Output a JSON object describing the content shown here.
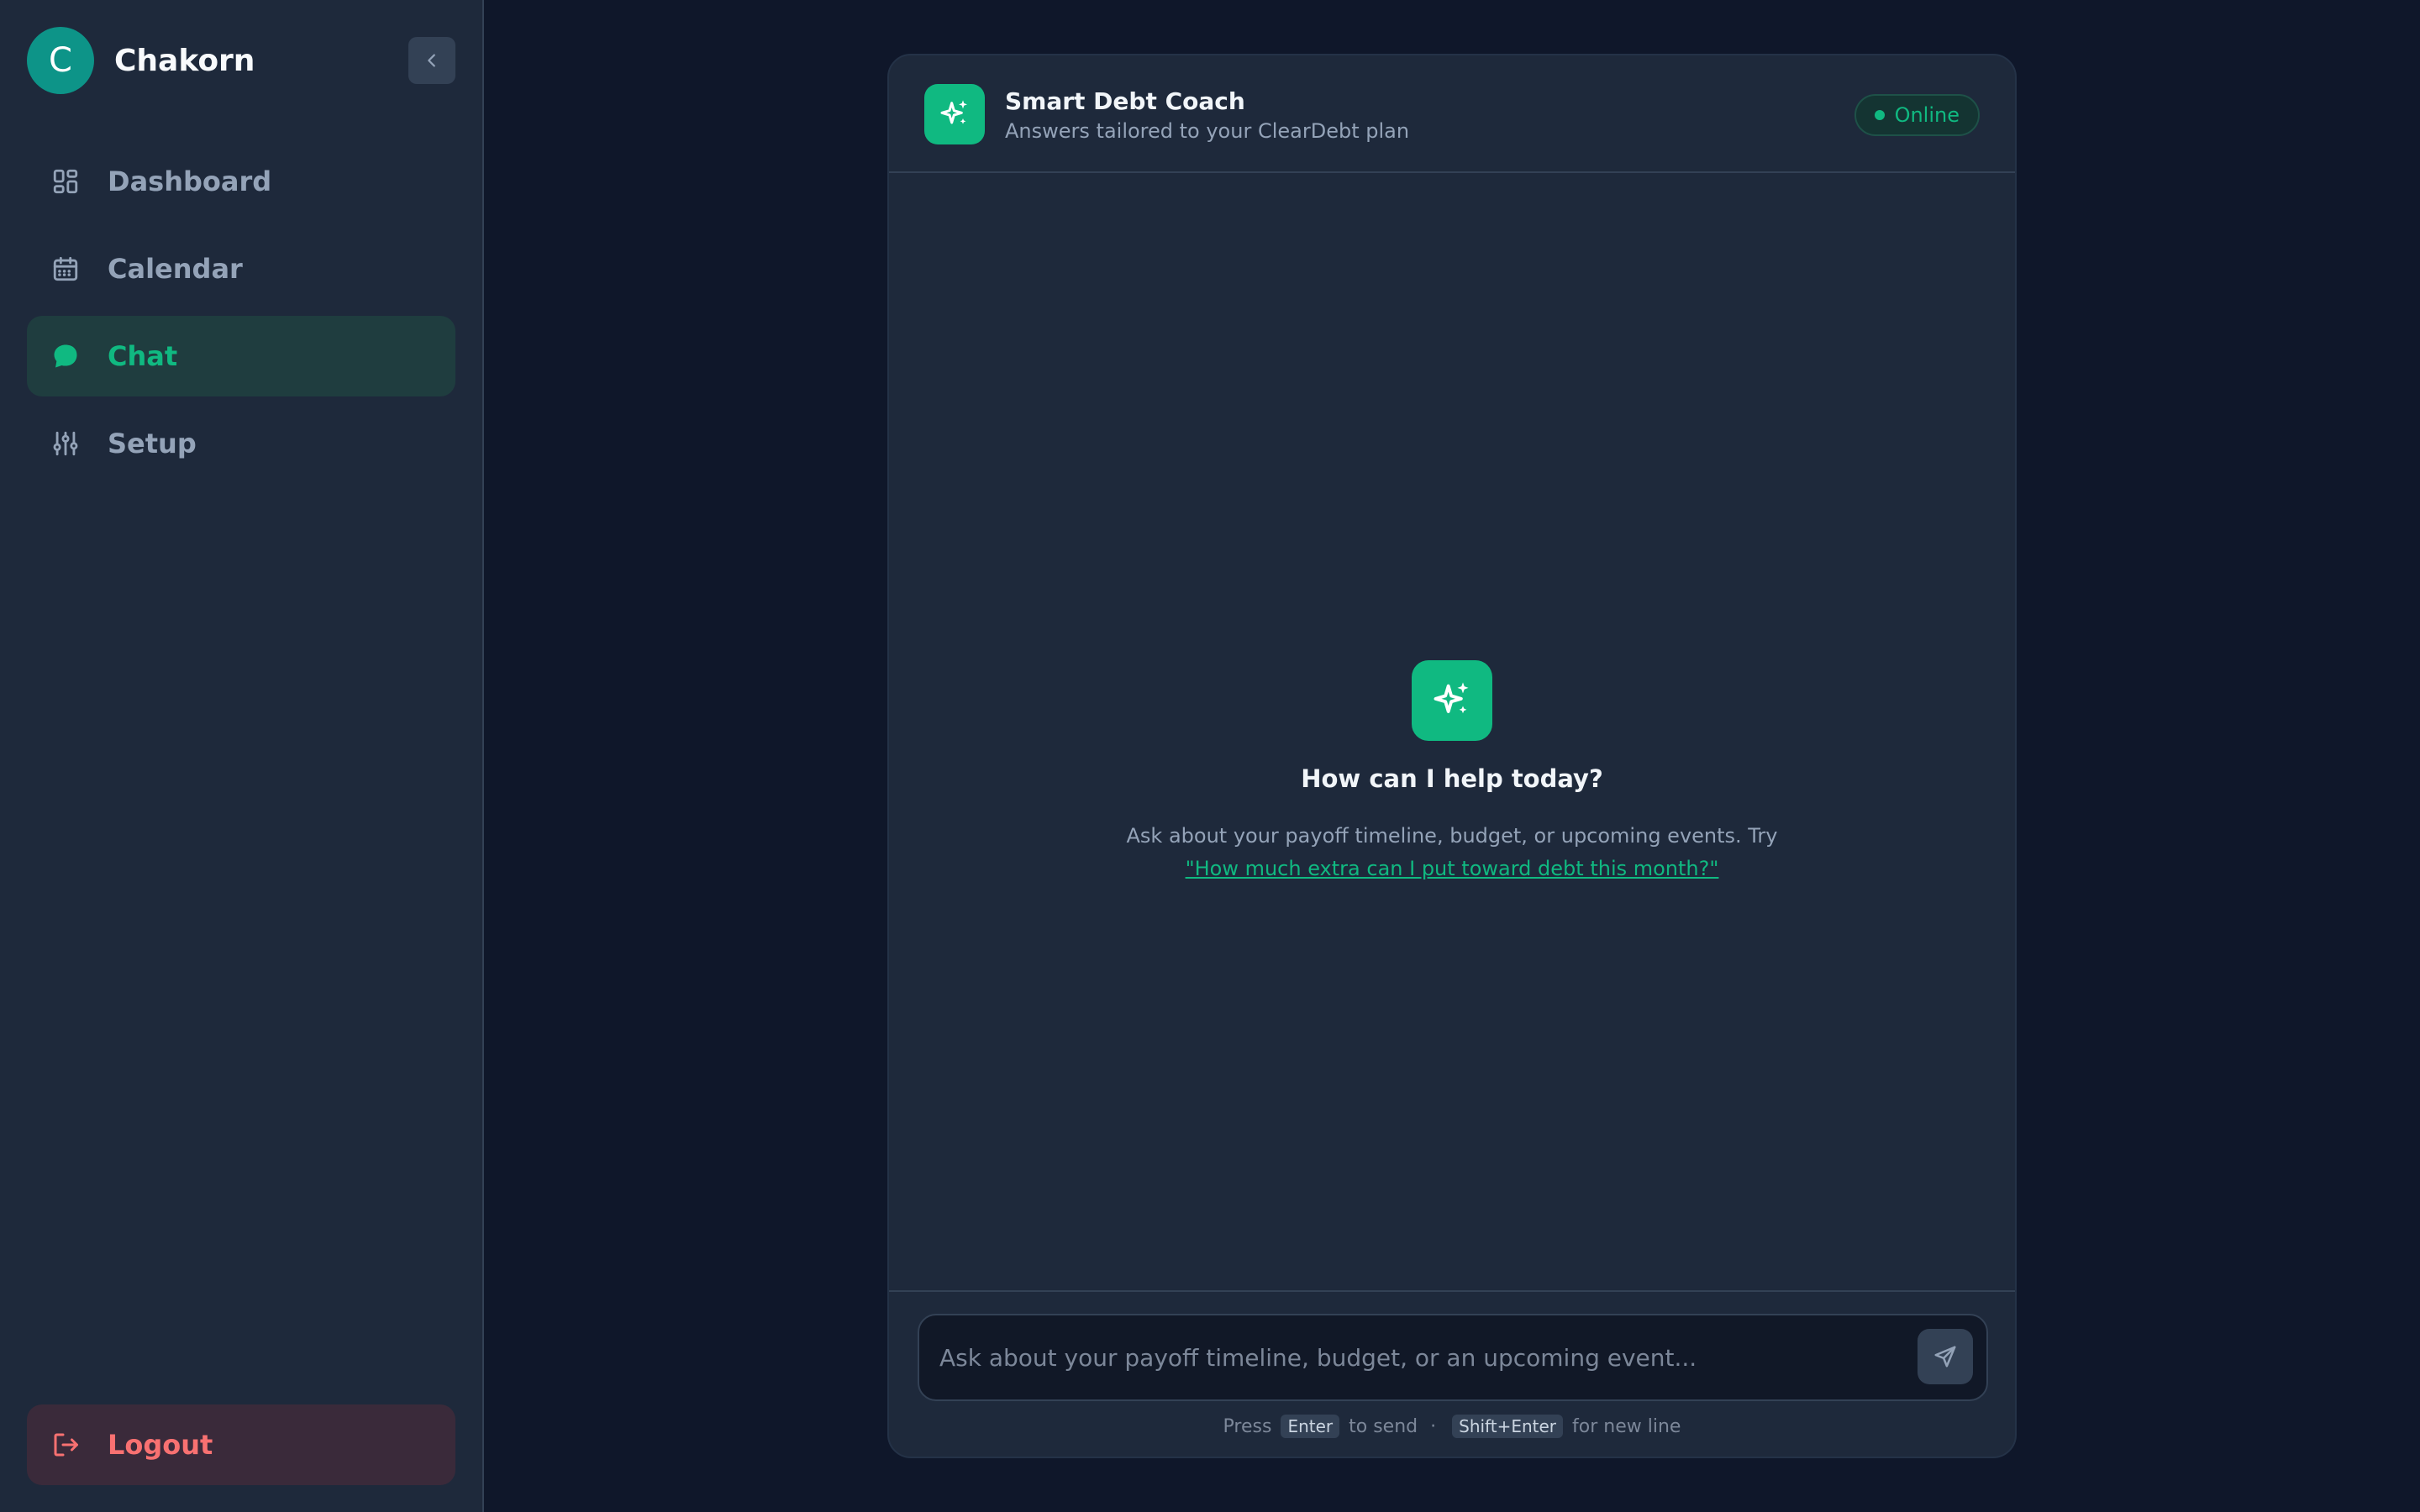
{
  "sidebar": {
    "avatar_initial": "C",
    "user_name": "Chakorn",
    "collapse_icon": "chevron-left-icon",
    "nav": [
      {
        "label": "Dashboard",
        "icon": "dashboard-grid-icon",
        "active": false
      },
      {
        "label": "Calendar",
        "icon": "calendar-icon",
        "active": false
      },
      {
        "label": "Chat",
        "icon": "chat-bubble-icon",
        "active": true
      },
      {
        "label": "Setup",
        "icon": "sliders-icon",
        "active": false
      }
    ],
    "logout_label": "Logout",
    "logout_icon": "logout-icon"
  },
  "chat": {
    "title": "Smart Debt Coach",
    "subtitle": "Answers tailored to your ClearDebt plan",
    "status": "Online",
    "bot_icon": "sparkles-icon",
    "empty_title": "How can I help today?",
    "empty_desc": "Ask about your payoff timeline, budget, or upcoming events. Try",
    "empty_suggestion": "\"How much extra can I put toward debt this month?\"",
    "input_placeholder": "Ask about your payoff timeline, budget, or an upcoming event...",
    "send_icon": "send-icon",
    "hint": {
      "press": "Press",
      "enter_key": "Enter",
      "to_send": "to send",
      "separator": "·",
      "shift_enter_key": "Shift+Enter",
      "new_line": "for new line"
    }
  },
  "colors": {
    "accent": "#10b981",
    "danger": "#f87171",
    "sidebar_bg": "#1e293b",
    "page_bg": "#0f172a"
  }
}
